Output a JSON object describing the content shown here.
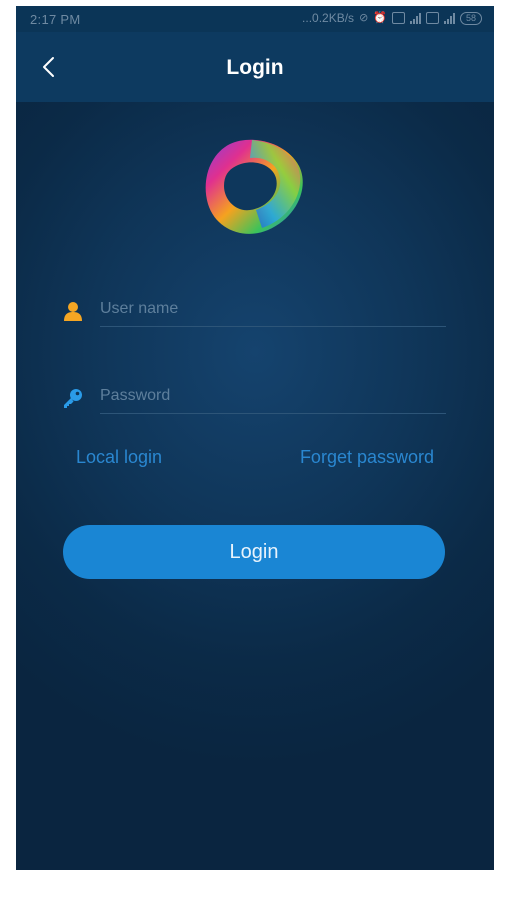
{
  "status_bar": {
    "time": "2:17 PM",
    "speed": "...0.2KB/s",
    "battery": "58"
  },
  "nav": {
    "title": "Login"
  },
  "form": {
    "username_placeholder": "User name",
    "username_value": "",
    "password_placeholder": "Password",
    "password_value": ""
  },
  "links": {
    "local_login": "Local login",
    "forget_password": "Forget password"
  },
  "login_button": {
    "label": "Login"
  },
  "colors": {
    "background": "#0a2540",
    "nav_bar": "#0d3a60",
    "accent": "#1a86d4",
    "link": "#2a87d0",
    "user_icon": "#f5a623",
    "key_icon": "#2a9be8"
  },
  "icons": {
    "back": "chevron-left-icon",
    "user": "user-icon",
    "password": "key-icon",
    "logo": "app-logo"
  }
}
